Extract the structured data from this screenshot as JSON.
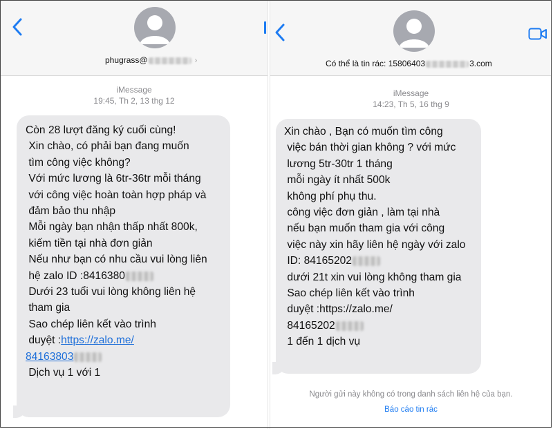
{
  "left": {
    "contact_prefix": "phugrass@",
    "service": "iMessage",
    "timestamp": "19:45, Th 2, 13 thg 12",
    "message": {
      "lines": [
        "Còn 28 lượt đăng ký cuối cùng!",
        " Xin chào, có phải bạn đang muốn",
        " tìm công việc không?",
        " Với mức lương là 6tr-36tr mỗi tháng",
        " với công việc hoàn toàn hợp pháp và",
        " đảm bảo thu nhập",
        " Mỗi ngày bạn nhận thấp nhất 800k,",
        " kiếm tiền tại nhà đơn giản",
        " Nếu như bạn có nhu cầu vui lòng liên",
        " hệ zalo ID :8416380",
        " Dưới 23 tuổi vui lòng không liên hệ",
        " tham gia",
        " Sao chép liên kết vào trình",
        " duyệt :",
        "https://zalo.me/",
        "84163803",
        " Dịch vụ 1 với 1"
      ]
    }
  },
  "right": {
    "contact_prefix": "Có thể là tin rác: 15806403",
    "contact_suffix": "3.com",
    "service": "iMessage",
    "timestamp": "14:23, Th 5, 16 thg 9",
    "message": {
      "lines": [
        "Xin chào , Bạn có muốn tìm công",
        " việc bán thời gian không ? với mức",
        " lương 5tr-30tr 1 tháng",
        " mỗi ngày ít nhất 500k",
        " không phí phụ thu.",
        " công việc đơn giản , làm tại nhà",
        " nếu bạn muốn tham gia với công",
        " việc này xin hãy liên hệ ngày với zalo",
        " ID: 84165202",
        " dưới 21t xin vui lòng không tham gia",
        " Sao chép liên kết vào trình",
        " duyệt :https://zalo.me/",
        " 84165202",
        " 1 đến 1 dịch vụ"
      ]
    },
    "notice": "Người gửi này không có trong danh sách liên hệ của bạn.",
    "report_label": "Báo cáo tin rác"
  },
  "colors": {
    "accent": "#1e7cf2",
    "bubble": "#e9e9eb",
    "header": "#f6f6f6",
    "meta_text": "#8a8a8e"
  },
  "icons": [
    "chevron-left-icon",
    "contact-avatar-icon",
    "video-call-icon",
    "chevron-right-icon"
  ]
}
